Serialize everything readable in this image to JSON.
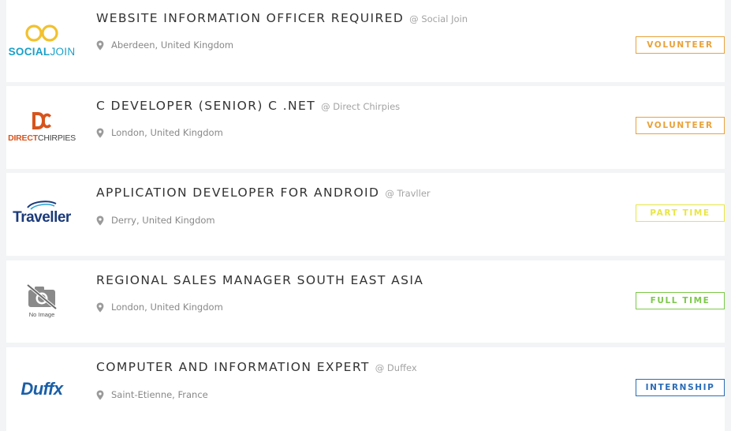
{
  "colors": {
    "volunteer": "#e8a23a",
    "part_time": "#e8e646",
    "full_time": "#7cc94a",
    "internship": "#2b6cb8"
  },
  "jobs": [
    {
      "title": "WEBSITE INFORMATION OFFICER REQUIRED",
      "company": "@ Social Join",
      "location": "Aberdeen, United Kingdom",
      "type": "VOLUNTEER",
      "logo": {
        "part_a": "SOCIAL",
        "part_b": "JOIN"
      }
    },
    {
      "title": "C DEVELOPER (SENIOR) C .NET",
      "company": "@ Direct Chirpies",
      "location": "London, United Kingdom",
      "type": "VOLUNTEER",
      "logo": {
        "part_a": "DIRECT",
        "part_b": "CHIRPIES"
      }
    },
    {
      "title": "APPLICATION DEVELOPER FOR ANDROID",
      "company": "@ Travller",
      "location": "Derry, United Kingdom",
      "type": "PART TIME",
      "logo": {
        "text": "Traveller"
      }
    },
    {
      "title": "REGIONAL SALES MANAGER SOUTH EAST ASIA",
      "company": "",
      "location": "London, United Kingdom",
      "type": "FULL TIME",
      "logo": {
        "text": "No Image"
      }
    },
    {
      "title": "COMPUTER AND INFORMATION EXPERT",
      "company": "@ Duffex",
      "location": "Saint-Etienne, France",
      "type": "INTERNSHIP",
      "logo": {
        "text": "Duffx"
      }
    }
  ]
}
